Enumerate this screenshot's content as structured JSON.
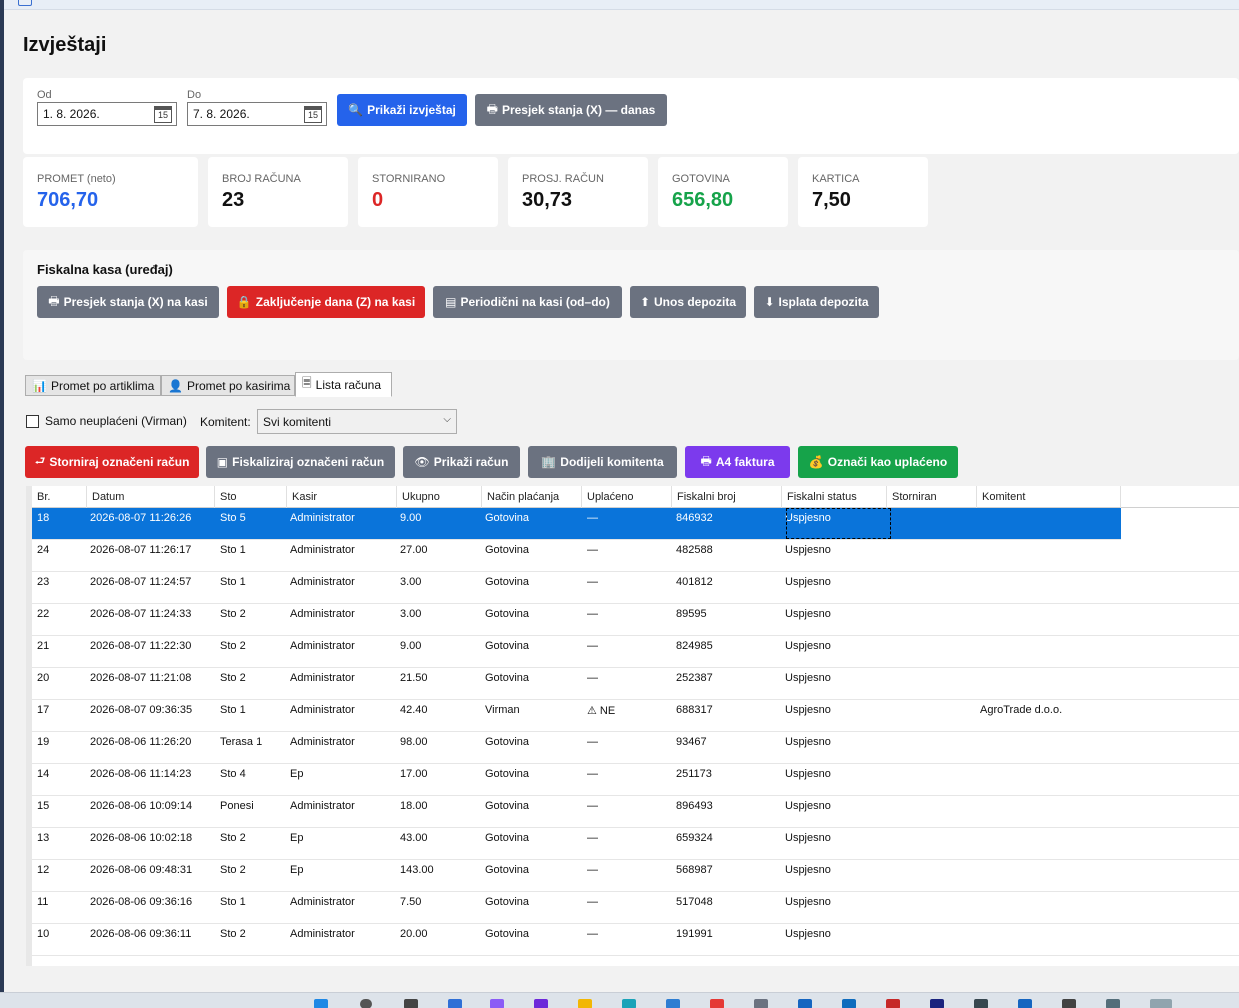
{
  "page": {
    "title": "Izvještaji"
  },
  "filter": {
    "from_label": "Od",
    "from_value": "1. 8. 2026.",
    "to_label": "Do",
    "to_value": "7. 8. 2026.",
    "calendar_day": "15",
    "show_report": "Prikaži izvještaj",
    "x_report_today": "Presjek stanja (X) — danas"
  },
  "kpis": [
    {
      "label": "PROMET (neto)",
      "value": "706,70",
      "color": "#2563eb"
    },
    {
      "label": "BROJ RAČUNA",
      "value": "23",
      "color": "#111111"
    },
    {
      "label": "STORNIRANO",
      "value": "0",
      "color": "#dc2626"
    },
    {
      "label": "PROSJ. RAČUN",
      "value": "30,73",
      "color": "#111111"
    },
    {
      "label": "GOTOVINA",
      "value": "656,80",
      "color": "#16a34a"
    },
    {
      "label": "KARTICA",
      "value": "7,50",
      "color": "#111111"
    }
  ],
  "fiscal": {
    "title": "Fiskalna kasa (uređaj)",
    "x_report": "Presjek stanja (X) na kasi",
    "z_report": "Zaključenje dana (Z) na kasi",
    "periodic": "Periodični na kasi (od–do)",
    "deposit_in": "Unos depozita",
    "deposit_out": "Isplata depozita"
  },
  "tabs": [
    "Promet po artiklima",
    "Promet po kasirima",
    "Lista računa"
  ],
  "options": {
    "unpaid_only": "Samo neuplaćeni (Virman)",
    "client_label": "Komitent:",
    "client_value": "Svi komitenti"
  },
  "actions": {
    "storno": "Storniraj označeni račun",
    "fiscalize": "Fiskaliziraj označeni račun",
    "show": "Prikaži račun",
    "assign": "Dodijeli komitenta",
    "a4": "A4 faktura",
    "mark_paid": "Označi kao uplaćeno"
  },
  "table": {
    "columns": [
      "Br.",
      "Datum",
      "Sto",
      "Kasir",
      "Ukupno",
      "Način plaćanja",
      "Uplaćeno",
      "Fiskalni broj",
      "Fiskalni status",
      "Storniran",
      "Komitent"
    ],
    "rows": [
      [
        "18",
        "2026-08-07 11:26:26",
        "Sto 5",
        "Administrator",
        "9.00",
        "Gotovina",
        "—",
        "846932",
        "Uspjesno",
        "",
        ""
      ],
      [
        "24",
        "2026-08-07 11:26:17",
        "Sto 1",
        "Administrator",
        "27.00",
        "Gotovina",
        "—",
        "482588",
        "Uspjesno",
        "",
        ""
      ],
      [
        "23",
        "2026-08-07 11:24:57",
        "Sto 1",
        "Administrator",
        "3.00",
        "Gotovina",
        "—",
        "401812",
        "Uspjesno",
        "",
        ""
      ],
      [
        "22",
        "2026-08-07 11:24:33",
        "Sto 2",
        "Administrator",
        "3.00",
        "Gotovina",
        "—",
        "89595",
        "Uspjesno",
        "",
        ""
      ],
      [
        "21",
        "2026-08-07 11:22:30",
        "Sto 2",
        "Administrator",
        "9.00",
        "Gotovina",
        "—",
        "824985",
        "Uspjesno",
        "",
        ""
      ],
      [
        "20",
        "2026-08-07 11:21:08",
        "Sto 2",
        "Administrator",
        "21.50",
        "Gotovina",
        "—",
        "252387",
        "Uspjesno",
        "",
        ""
      ],
      [
        "17",
        "2026-08-07 09:36:35",
        "Sto 1",
        "Administrator",
        "42.40",
        "Virman",
        "⚠ NE",
        "688317",
        "Uspjesno",
        "",
        "AgroTrade d.o.o."
      ],
      [
        "19",
        "2026-08-06 11:26:20",
        "Terasa 1",
        "Administrator",
        "98.00",
        "Gotovina",
        "—",
        "93467",
        "Uspjesno",
        "",
        ""
      ],
      [
        "14",
        "2026-08-06 11:14:23",
        "Sto 4",
        "Ep",
        "17.00",
        "Gotovina",
        "—",
        "251173",
        "Uspjesno",
        "",
        ""
      ],
      [
        "15",
        "2026-08-06 10:09:14",
        "Ponesi",
        "Administrator",
        "18.00",
        "Gotovina",
        "—",
        "896493",
        "Uspjesno",
        "",
        ""
      ],
      [
        "13",
        "2026-08-06 10:02:18",
        "Sto 2",
        "Ep",
        "43.00",
        "Gotovina",
        "—",
        "659324",
        "Uspjesno",
        "",
        ""
      ],
      [
        "12",
        "2026-08-06 09:48:31",
        "Sto 2",
        "Ep",
        "143.00",
        "Gotovina",
        "—",
        "568987",
        "Uspjesno",
        "",
        ""
      ],
      [
        "11",
        "2026-08-06 09:36:16",
        "Sto 1",
        "Administrator",
        "7.50",
        "Gotovina",
        "—",
        "517048",
        "Uspjesno",
        "",
        ""
      ],
      [
        "10",
        "2026-08-06 09:36:11",
        "Sto 2",
        "Administrator",
        "20.00",
        "Gotovina",
        "—",
        "191991",
        "Uspjesno",
        "",
        ""
      ]
    ]
  }
}
